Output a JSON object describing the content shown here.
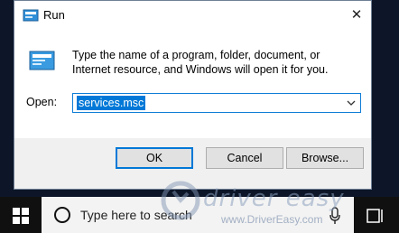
{
  "dialog": {
    "title": "Run",
    "description": "Type the name of a program, folder, document, or Internet resource, and Windows will open it for you.",
    "open_label": "Open:",
    "open_value": "services.msc",
    "buttons": {
      "ok": "OK",
      "cancel": "Cancel",
      "browse": "Browse..."
    }
  },
  "taskbar": {
    "search_placeholder": "Type here to search"
  },
  "watermark": {
    "brand": "driver easy",
    "url": "www.DriverEasy.com"
  },
  "colors": {
    "accent": "#0078d7",
    "taskbar": "#101010",
    "selection": "#0078d7"
  }
}
